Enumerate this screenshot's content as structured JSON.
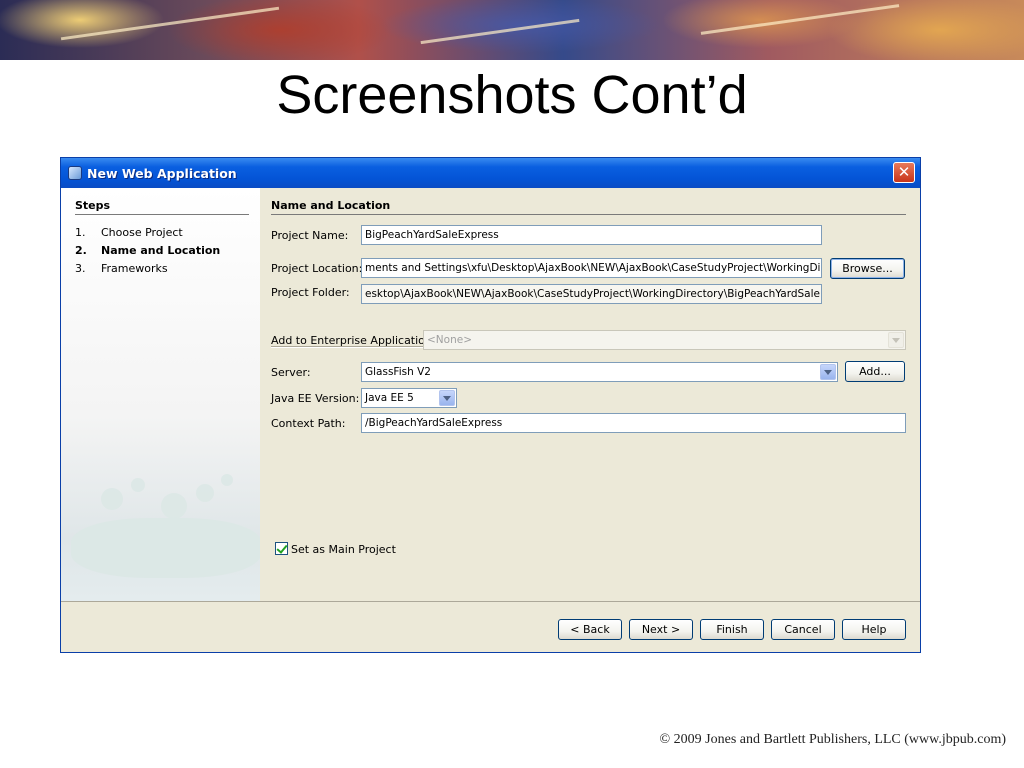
{
  "slide": {
    "title": "Screenshots Cont’d",
    "copyright": "© 2009 Jones and Bartlett Publishers, LLC (www.jbpub.com)"
  },
  "dialog": {
    "title": "New Web Application",
    "close_label": "✕",
    "steps": {
      "heading": "Steps",
      "items": [
        {
          "num": "1.",
          "label": "Choose Project",
          "active": false
        },
        {
          "num": "2.",
          "label": "Name and Location",
          "active": true
        },
        {
          "num": "3.",
          "label": "Frameworks",
          "active": false
        }
      ]
    },
    "section_heading": "Name and Location",
    "project_name": {
      "label": "Project Name:",
      "value": "BigPeachYardSaleExpress"
    },
    "project_location": {
      "label": "Project Location:",
      "value": "ments and Settings\\xfu\\Desktop\\AjaxBook\\NEW\\AjaxBook\\CaseStudyProject\\WorkingDirectory",
      "browse_label": "Browse..."
    },
    "project_folder": {
      "label": "Project Folder:",
      "value": "esktop\\AjaxBook\\NEW\\AjaxBook\\CaseStudyProject\\WorkingDirectory\\BigPeachYardSaleExpress"
    },
    "enterprise_app": {
      "label": "Add to Enterprise Application:",
      "value": "<None>"
    },
    "server": {
      "label": "Server:",
      "value": "GlassFish V2",
      "add_label": "Add..."
    },
    "java_ee": {
      "label": "Java EE Version:",
      "value": "Java EE 5"
    },
    "context_path": {
      "label": "Context Path:",
      "value": "/BigPeachYardSaleExpress"
    },
    "main_project": {
      "label": "Set as Main Project",
      "checked": true
    },
    "buttons": {
      "back": "< Back",
      "next": "Next >",
      "finish": "Finish",
      "cancel": "Cancel",
      "help": "Help"
    }
  }
}
